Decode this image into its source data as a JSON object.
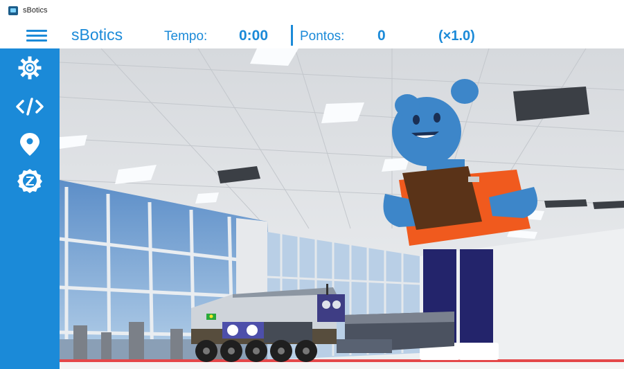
{
  "window": {
    "title": "sBotics"
  },
  "header": {
    "app_name": "sBotics",
    "tempo_label": "Tempo:",
    "tempo_value": "0:00",
    "separator": "|",
    "pontos_label": "Pontos:",
    "pontos_value": "0",
    "speed": "(×1.0)"
  },
  "sidebar": {
    "items": [
      {
        "icon": "gear-icon"
      },
      {
        "icon": "code-icon"
      },
      {
        "icon": "map-pin-icon"
      },
      {
        "icon": "badge-icon"
      }
    ]
  },
  "scene": {
    "flag_color": "#2aa93b",
    "mascot_color": "#3d86c9",
    "shirt_color": "#f05a1e",
    "pants_color": "#23246b",
    "clipboard_color": "#5a3318"
  },
  "colors": {
    "accent": "#1b8ad8"
  }
}
